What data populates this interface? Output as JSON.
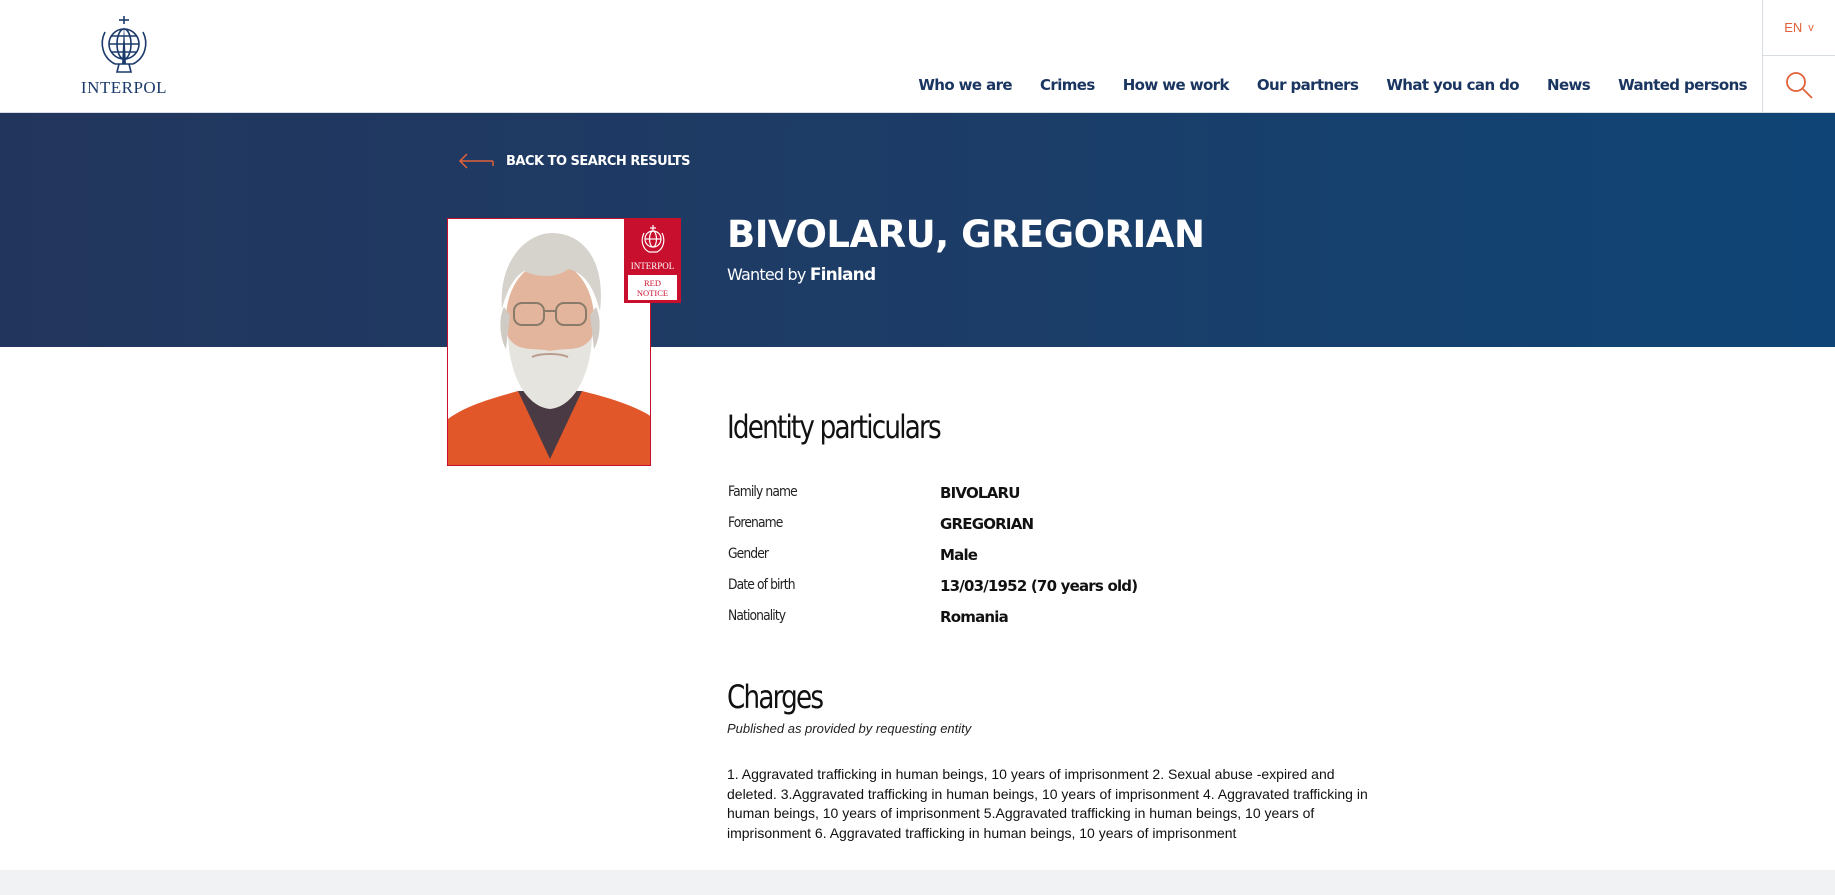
{
  "header": {
    "logo_text": "INTERPOL",
    "nav": [
      "Who we are",
      "Crimes",
      "How we work",
      "Our partners",
      "What you can do",
      "News",
      "Wanted persons"
    ],
    "language": "EN",
    "language_caret": "v"
  },
  "banner": {
    "back_label": "BACK TO SEARCH RESULTS",
    "name": "BIVOLARU, GREGORIAN",
    "wanted_by_prefix": "Wanted by",
    "wanted_by_country": "Finland"
  },
  "notice_badge": {
    "org": "INTERPOL",
    "line1": "RED",
    "line2": "NOTICE"
  },
  "identity": {
    "title": "Identity particulars",
    "rows": [
      {
        "label": "Family name",
        "value": "BIVOLARU"
      },
      {
        "label": "Forename",
        "value": "GREGORIAN"
      },
      {
        "label": "Gender",
        "value": "Male"
      },
      {
        "label": "Date of birth",
        "value": "13/03/1952 (70 years old)"
      },
      {
        "label": "Nationality",
        "value": "Romania"
      }
    ]
  },
  "charges": {
    "title": "Charges",
    "subtitle": "Published as provided by requesting entity",
    "text": "1. Aggravated trafficking in human beings, 10 years of imprisonment 2. Sexual abuse -expired and deleted. 3.Aggravated trafficking in human beings, 10 years of imprisonment 4. Aggravated trafficking in human beings, 10 years of imprisonment 5.Aggravated trafficking in human beings, 10 years of imprisonment 6. Aggravated trafficking in human beings, 10 years of imprisonment"
  },
  "colors": {
    "accent": "#e0613a",
    "navy": "#1c3d68",
    "notice_red": "#c8102e"
  },
  "icons": {
    "logo": "interpol-globe-emblem",
    "back": "arrow-left-icon",
    "search": "search-icon"
  }
}
